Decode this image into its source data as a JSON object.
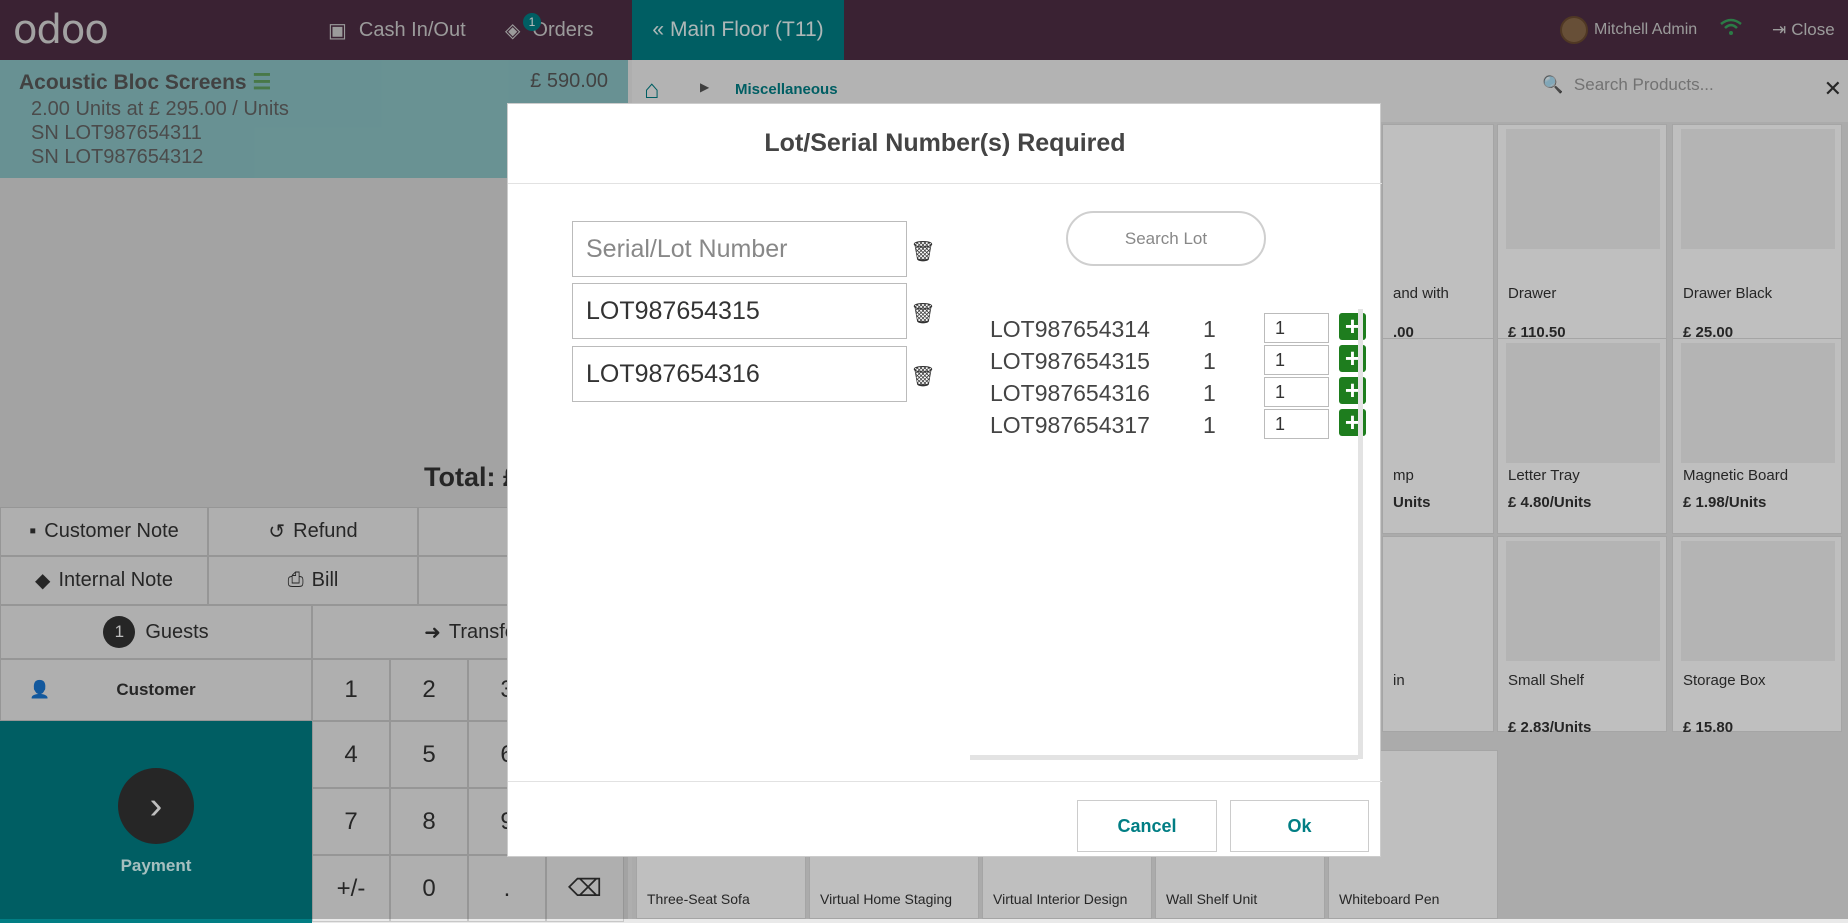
{
  "topbar": {
    "logo": "odoo",
    "cash": "Cash In/Out",
    "orders": "Orders",
    "orders_badge": "1",
    "floor": "Main Floor (T11)",
    "user": "Mitchell Admin",
    "close": "Close"
  },
  "order": {
    "product": "Acoustic Bloc Screens",
    "price": "£ 590.00",
    "qty_line": "2.00 Units at £ 295.00 / Units",
    "sn1": "SN LOT987654311",
    "sn2": "SN LOT987654312",
    "total": "Total: £"
  },
  "controls": {
    "customer_note": "Customer Note",
    "refund": "Refund",
    "internal_note": "Internal Note",
    "bill": "Bill",
    "guests_count": "1",
    "guests": "Guests",
    "transfer": "Transfe",
    "customer": "Customer",
    "payment": "Payment"
  },
  "keys": [
    "1",
    "2",
    "3",
    "4",
    "5",
    "6",
    "7",
    "8",
    "9",
    "+/-",
    "0",
    ".",
    "⌫"
  ],
  "products": {
    "breadcrumb": "Miscellaneous",
    "search_placeholder": "Search Products...",
    "tiles": [
      {
        "name": "Drawer",
        "price": "£ 110.50"
      },
      {
        "name": "Drawer Black",
        "price": "£ 25.00"
      },
      {
        "name": "Letter Tray",
        "price": "£ 4.80/Units"
      },
      {
        "name": "Magnetic Board",
        "price": "£ 1.98/Units"
      },
      {
        "name": "Small Shelf",
        "price": "£ 2.83/Units"
      },
      {
        "name": "Storage Box",
        "price": "£ 15.80"
      }
    ],
    "partial": [
      "and with",
      ".00",
      "mp",
      "Units",
      "in"
    ],
    "bottom_row": [
      "Three-Seat Sofa",
      "Virtual Home Staging",
      "Virtual Interior Design",
      "Wall Shelf Unit",
      "Whiteboard Pen"
    ]
  },
  "modal": {
    "title": "Lot/Serial Number(s) Required",
    "input_placeholder": "Serial/Lot Number",
    "inputs": [
      "LOT987654315",
      "LOT987654316"
    ],
    "search_lot": "Search Lot",
    "lots": [
      {
        "name": "LOT987654314",
        "qty": "1",
        "value": "1"
      },
      {
        "name": "LOT987654315",
        "qty": "1",
        "value": "1"
      },
      {
        "name": "LOT987654316",
        "qty": "1",
        "value": "1"
      },
      {
        "name": "LOT987654317",
        "qty": "1",
        "value": "1"
      }
    ],
    "cancel": "Cancel",
    "ok": "Ok"
  }
}
